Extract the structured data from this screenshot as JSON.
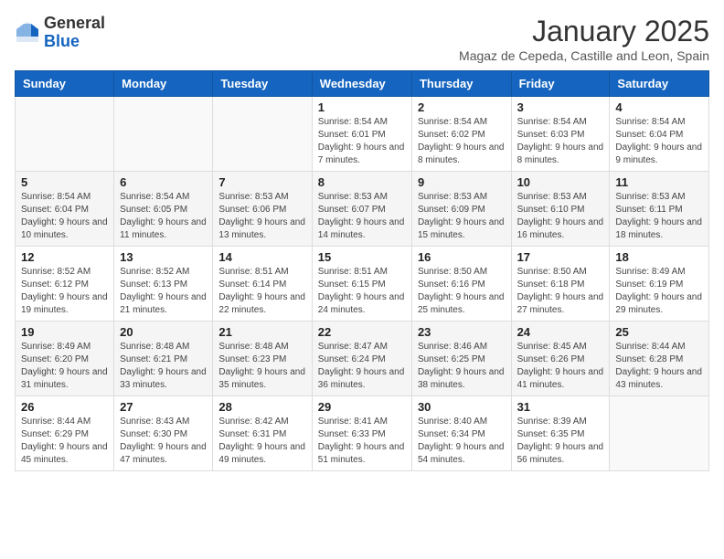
{
  "logo": {
    "general": "General",
    "blue": "Blue"
  },
  "header": {
    "month": "January 2025",
    "location": "Magaz de Cepeda, Castille and Leon, Spain"
  },
  "days_of_week": [
    "Sunday",
    "Monday",
    "Tuesday",
    "Wednesday",
    "Thursday",
    "Friday",
    "Saturday"
  ],
  "weeks": [
    [
      {
        "day": "",
        "info": ""
      },
      {
        "day": "",
        "info": ""
      },
      {
        "day": "",
        "info": ""
      },
      {
        "day": "1",
        "info": "Sunrise: 8:54 AM\nSunset: 6:01 PM\nDaylight: 9 hours and 7 minutes."
      },
      {
        "day": "2",
        "info": "Sunrise: 8:54 AM\nSunset: 6:02 PM\nDaylight: 9 hours and 8 minutes."
      },
      {
        "day": "3",
        "info": "Sunrise: 8:54 AM\nSunset: 6:03 PM\nDaylight: 9 hours and 8 minutes."
      },
      {
        "day": "4",
        "info": "Sunrise: 8:54 AM\nSunset: 6:04 PM\nDaylight: 9 hours and 9 minutes."
      }
    ],
    [
      {
        "day": "5",
        "info": "Sunrise: 8:54 AM\nSunset: 6:04 PM\nDaylight: 9 hours and 10 minutes."
      },
      {
        "day": "6",
        "info": "Sunrise: 8:54 AM\nSunset: 6:05 PM\nDaylight: 9 hours and 11 minutes."
      },
      {
        "day": "7",
        "info": "Sunrise: 8:53 AM\nSunset: 6:06 PM\nDaylight: 9 hours and 13 minutes."
      },
      {
        "day": "8",
        "info": "Sunrise: 8:53 AM\nSunset: 6:07 PM\nDaylight: 9 hours and 14 minutes."
      },
      {
        "day": "9",
        "info": "Sunrise: 8:53 AM\nSunset: 6:09 PM\nDaylight: 9 hours and 15 minutes."
      },
      {
        "day": "10",
        "info": "Sunrise: 8:53 AM\nSunset: 6:10 PM\nDaylight: 9 hours and 16 minutes."
      },
      {
        "day": "11",
        "info": "Sunrise: 8:53 AM\nSunset: 6:11 PM\nDaylight: 9 hours and 18 minutes."
      }
    ],
    [
      {
        "day": "12",
        "info": "Sunrise: 8:52 AM\nSunset: 6:12 PM\nDaylight: 9 hours and 19 minutes."
      },
      {
        "day": "13",
        "info": "Sunrise: 8:52 AM\nSunset: 6:13 PM\nDaylight: 9 hours and 21 minutes."
      },
      {
        "day": "14",
        "info": "Sunrise: 8:51 AM\nSunset: 6:14 PM\nDaylight: 9 hours and 22 minutes."
      },
      {
        "day": "15",
        "info": "Sunrise: 8:51 AM\nSunset: 6:15 PM\nDaylight: 9 hours and 24 minutes."
      },
      {
        "day": "16",
        "info": "Sunrise: 8:50 AM\nSunset: 6:16 PM\nDaylight: 9 hours and 25 minutes."
      },
      {
        "day": "17",
        "info": "Sunrise: 8:50 AM\nSunset: 6:18 PM\nDaylight: 9 hours and 27 minutes."
      },
      {
        "day": "18",
        "info": "Sunrise: 8:49 AM\nSunset: 6:19 PM\nDaylight: 9 hours and 29 minutes."
      }
    ],
    [
      {
        "day": "19",
        "info": "Sunrise: 8:49 AM\nSunset: 6:20 PM\nDaylight: 9 hours and 31 minutes."
      },
      {
        "day": "20",
        "info": "Sunrise: 8:48 AM\nSunset: 6:21 PM\nDaylight: 9 hours and 33 minutes."
      },
      {
        "day": "21",
        "info": "Sunrise: 8:48 AM\nSunset: 6:23 PM\nDaylight: 9 hours and 35 minutes."
      },
      {
        "day": "22",
        "info": "Sunrise: 8:47 AM\nSunset: 6:24 PM\nDaylight: 9 hours and 36 minutes."
      },
      {
        "day": "23",
        "info": "Sunrise: 8:46 AM\nSunset: 6:25 PM\nDaylight: 9 hours and 38 minutes."
      },
      {
        "day": "24",
        "info": "Sunrise: 8:45 AM\nSunset: 6:26 PM\nDaylight: 9 hours and 41 minutes."
      },
      {
        "day": "25",
        "info": "Sunrise: 8:44 AM\nSunset: 6:28 PM\nDaylight: 9 hours and 43 minutes."
      }
    ],
    [
      {
        "day": "26",
        "info": "Sunrise: 8:44 AM\nSunset: 6:29 PM\nDaylight: 9 hours and 45 minutes."
      },
      {
        "day": "27",
        "info": "Sunrise: 8:43 AM\nSunset: 6:30 PM\nDaylight: 9 hours and 47 minutes."
      },
      {
        "day": "28",
        "info": "Sunrise: 8:42 AM\nSunset: 6:31 PM\nDaylight: 9 hours and 49 minutes."
      },
      {
        "day": "29",
        "info": "Sunrise: 8:41 AM\nSunset: 6:33 PM\nDaylight: 9 hours and 51 minutes."
      },
      {
        "day": "30",
        "info": "Sunrise: 8:40 AM\nSunset: 6:34 PM\nDaylight: 9 hours and 54 minutes."
      },
      {
        "day": "31",
        "info": "Sunrise: 8:39 AM\nSunset: 6:35 PM\nDaylight: 9 hours and 56 minutes."
      },
      {
        "day": "",
        "info": ""
      }
    ]
  ]
}
